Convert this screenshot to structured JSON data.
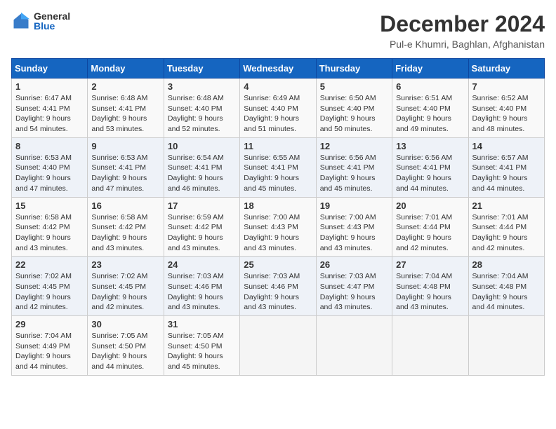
{
  "header": {
    "logo_general": "General",
    "logo_blue": "Blue",
    "month_title": "December 2024",
    "location": "Pul-e Khumri, Baghlan, Afghanistan"
  },
  "days_of_week": [
    "Sunday",
    "Monday",
    "Tuesday",
    "Wednesday",
    "Thursday",
    "Friday",
    "Saturday"
  ],
  "weeks": [
    [
      {
        "day": "1",
        "sunrise": "Sunrise: 6:47 AM",
        "sunset": "Sunset: 4:41 PM",
        "daylight": "Daylight: 9 hours and 54 minutes."
      },
      {
        "day": "2",
        "sunrise": "Sunrise: 6:48 AM",
        "sunset": "Sunset: 4:41 PM",
        "daylight": "Daylight: 9 hours and 53 minutes."
      },
      {
        "day": "3",
        "sunrise": "Sunrise: 6:48 AM",
        "sunset": "Sunset: 4:40 PM",
        "daylight": "Daylight: 9 hours and 52 minutes."
      },
      {
        "day": "4",
        "sunrise": "Sunrise: 6:49 AM",
        "sunset": "Sunset: 4:40 PM",
        "daylight": "Daylight: 9 hours and 51 minutes."
      },
      {
        "day": "5",
        "sunrise": "Sunrise: 6:50 AM",
        "sunset": "Sunset: 4:40 PM",
        "daylight": "Daylight: 9 hours and 50 minutes."
      },
      {
        "day": "6",
        "sunrise": "Sunrise: 6:51 AM",
        "sunset": "Sunset: 4:40 PM",
        "daylight": "Daylight: 9 hours and 49 minutes."
      },
      {
        "day": "7",
        "sunrise": "Sunrise: 6:52 AM",
        "sunset": "Sunset: 4:40 PM",
        "daylight": "Daylight: 9 hours and 48 minutes."
      }
    ],
    [
      {
        "day": "8",
        "sunrise": "Sunrise: 6:53 AM",
        "sunset": "Sunset: 4:40 PM",
        "daylight": "Daylight: 9 hours and 47 minutes."
      },
      {
        "day": "9",
        "sunrise": "Sunrise: 6:53 AM",
        "sunset": "Sunset: 4:41 PM",
        "daylight": "Daylight: 9 hours and 47 minutes."
      },
      {
        "day": "10",
        "sunrise": "Sunrise: 6:54 AM",
        "sunset": "Sunset: 4:41 PM",
        "daylight": "Daylight: 9 hours and 46 minutes."
      },
      {
        "day": "11",
        "sunrise": "Sunrise: 6:55 AM",
        "sunset": "Sunset: 4:41 PM",
        "daylight": "Daylight: 9 hours and 45 minutes."
      },
      {
        "day": "12",
        "sunrise": "Sunrise: 6:56 AM",
        "sunset": "Sunset: 4:41 PM",
        "daylight": "Daylight: 9 hours and 45 minutes."
      },
      {
        "day": "13",
        "sunrise": "Sunrise: 6:56 AM",
        "sunset": "Sunset: 4:41 PM",
        "daylight": "Daylight: 9 hours and 44 minutes."
      },
      {
        "day": "14",
        "sunrise": "Sunrise: 6:57 AM",
        "sunset": "Sunset: 4:41 PM",
        "daylight": "Daylight: 9 hours and 44 minutes."
      }
    ],
    [
      {
        "day": "15",
        "sunrise": "Sunrise: 6:58 AM",
        "sunset": "Sunset: 4:42 PM",
        "daylight": "Daylight: 9 hours and 43 minutes."
      },
      {
        "day": "16",
        "sunrise": "Sunrise: 6:58 AM",
        "sunset": "Sunset: 4:42 PM",
        "daylight": "Daylight: 9 hours and 43 minutes."
      },
      {
        "day": "17",
        "sunrise": "Sunrise: 6:59 AM",
        "sunset": "Sunset: 4:42 PM",
        "daylight": "Daylight: 9 hours and 43 minutes."
      },
      {
        "day": "18",
        "sunrise": "Sunrise: 7:00 AM",
        "sunset": "Sunset: 4:43 PM",
        "daylight": "Daylight: 9 hours and 43 minutes."
      },
      {
        "day": "19",
        "sunrise": "Sunrise: 7:00 AM",
        "sunset": "Sunset: 4:43 PM",
        "daylight": "Daylight: 9 hours and 43 minutes."
      },
      {
        "day": "20",
        "sunrise": "Sunrise: 7:01 AM",
        "sunset": "Sunset: 4:44 PM",
        "daylight": "Daylight: 9 hours and 42 minutes."
      },
      {
        "day": "21",
        "sunrise": "Sunrise: 7:01 AM",
        "sunset": "Sunset: 4:44 PM",
        "daylight": "Daylight: 9 hours and 42 minutes."
      }
    ],
    [
      {
        "day": "22",
        "sunrise": "Sunrise: 7:02 AM",
        "sunset": "Sunset: 4:45 PM",
        "daylight": "Daylight: 9 hours and 42 minutes."
      },
      {
        "day": "23",
        "sunrise": "Sunrise: 7:02 AM",
        "sunset": "Sunset: 4:45 PM",
        "daylight": "Daylight: 9 hours and 42 minutes."
      },
      {
        "day": "24",
        "sunrise": "Sunrise: 7:03 AM",
        "sunset": "Sunset: 4:46 PM",
        "daylight": "Daylight: 9 hours and 43 minutes."
      },
      {
        "day": "25",
        "sunrise": "Sunrise: 7:03 AM",
        "sunset": "Sunset: 4:46 PM",
        "daylight": "Daylight: 9 hours and 43 minutes."
      },
      {
        "day": "26",
        "sunrise": "Sunrise: 7:03 AM",
        "sunset": "Sunset: 4:47 PM",
        "daylight": "Daylight: 9 hours and 43 minutes."
      },
      {
        "day": "27",
        "sunrise": "Sunrise: 7:04 AM",
        "sunset": "Sunset: 4:48 PM",
        "daylight": "Daylight: 9 hours and 43 minutes."
      },
      {
        "day": "28",
        "sunrise": "Sunrise: 7:04 AM",
        "sunset": "Sunset: 4:48 PM",
        "daylight": "Daylight: 9 hours and 44 minutes."
      }
    ],
    [
      {
        "day": "29",
        "sunrise": "Sunrise: 7:04 AM",
        "sunset": "Sunset: 4:49 PM",
        "daylight": "Daylight: 9 hours and 44 minutes."
      },
      {
        "day": "30",
        "sunrise": "Sunrise: 7:05 AM",
        "sunset": "Sunset: 4:50 PM",
        "daylight": "Daylight: 9 hours and 44 minutes."
      },
      {
        "day": "31",
        "sunrise": "Sunrise: 7:05 AM",
        "sunset": "Sunset: 4:50 PM",
        "daylight": "Daylight: 9 hours and 45 minutes."
      },
      null,
      null,
      null,
      null
    ]
  ]
}
